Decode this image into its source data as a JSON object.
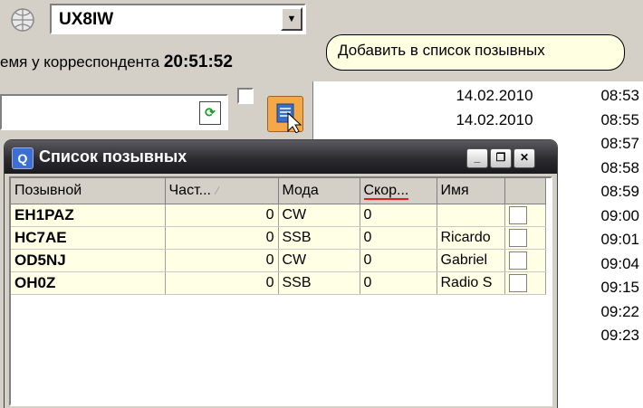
{
  "callsign_combo": {
    "value": "UX8IW"
  },
  "time_row": {
    "label": "емя у корреспондента",
    "value": "20:51:52"
  },
  "tooltip": {
    "text": "Добавить в список позывных"
  },
  "right_list": [
    {
      "date": "14.02.2010",
      "time": "08:53"
    },
    {
      "date": "14.02.2010",
      "time": "08:55"
    },
    {
      "date": "",
      "time": "08:57"
    },
    {
      "date": "",
      "time": "08:58"
    },
    {
      "date": "",
      "time": "08:59"
    },
    {
      "date": "",
      "time": "09:00"
    },
    {
      "date": "",
      "time": "09:01"
    },
    {
      "date": "",
      "time": "09:04"
    },
    {
      "date": "",
      "time": "09:15"
    },
    {
      "date": "",
      "time": "09:22"
    },
    {
      "date": "",
      "time": "09:23"
    }
  ],
  "window": {
    "title": "Список позывных",
    "columns": [
      "Позывной",
      "Част...",
      "Мода",
      "Скор...",
      "Имя",
      ""
    ],
    "rows": [
      {
        "call": "EH1PAZ",
        "freq": "0",
        "mode": "CW",
        "speed": "0",
        "name": ""
      },
      {
        "call": "HC7AE",
        "freq": "0",
        "mode": "SSB",
        "speed": "0",
        "name": "Ricardo"
      },
      {
        "call": "OD5NJ",
        "freq": "0",
        "mode": "CW",
        "speed": "0",
        "name": "Gabriel"
      },
      {
        "call": "OH0Z",
        "freq": "0",
        "mode": "SSB",
        "speed": "0",
        "name": "Radio S"
      }
    ]
  },
  "colors": {
    "titlebar": "#2c2c30",
    "row_bg": "#ffffe6",
    "tooltip_bg": "#ffffe1",
    "add_button": "#f4a848"
  }
}
